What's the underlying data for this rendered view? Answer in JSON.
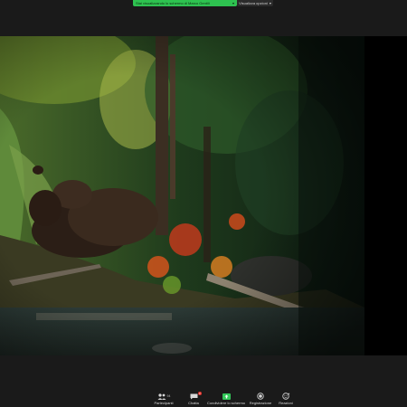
{
  "top": {
    "share_banner": "Stai visualizzando lo schermo di Marco Gentili",
    "view_options": "Visualizza opzioni"
  },
  "toolbar": {
    "participants": {
      "label": "Partecipanti",
      "count": "94"
    },
    "chat": {
      "label": "Chatta",
      "badge": "3"
    },
    "share": {
      "label": "Condividere lo schermo"
    },
    "record": {
      "label": "Registrazione"
    },
    "reactions": {
      "label": "Reazioni"
    }
  },
  "colors": {
    "share_green": "#2ec250",
    "bar_bg": "#1a1a1a",
    "badge_red": "#e0312b"
  }
}
